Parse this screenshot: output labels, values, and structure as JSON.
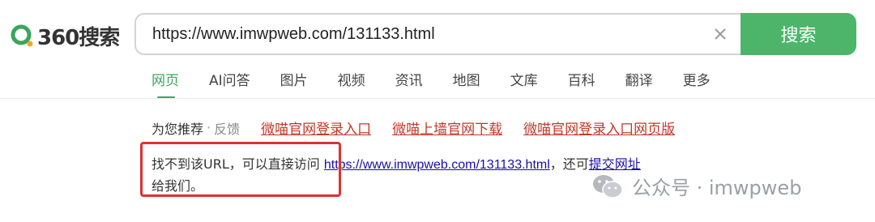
{
  "brand": {
    "logo_text": "360搜索",
    "accent": "#4db56a"
  },
  "search": {
    "query": "https://www.imwpweb.com/131133.html",
    "button_label": "搜索"
  },
  "tabs": [
    {
      "label": "网页",
      "active": true
    },
    {
      "label": "AI问答"
    },
    {
      "label": "图片"
    },
    {
      "label": "视频"
    },
    {
      "label": "资讯"
    },
    {
      "label": "地图"
    },
    {
      "label": "文库"
    },
    {
      "label": "百科"
    },
    {
      "label": "翻译"
    },
    {
      "label": "更多"
    }
  ],
  "recommend": {
    "label": "为您推荐",
    "dot": "·",
    "feedback": "反馈",
    "links": [
      "微喵官网登录入口",
      "微喵上墙官网下载",
      "微喵官网登录入口网页版"
    ]
  },
  "message": {
    "prefix": "找不到该URL，可以直接访问 ",
    "url": "https://www.imwpweb.com/131133.html",
    "middle": "，还可",
    "submit_link": "提交网址",
    "suffix": "给我们。"
  },
  "watermark": {
    "text": "公众号 · imwpweb"
  }
}
